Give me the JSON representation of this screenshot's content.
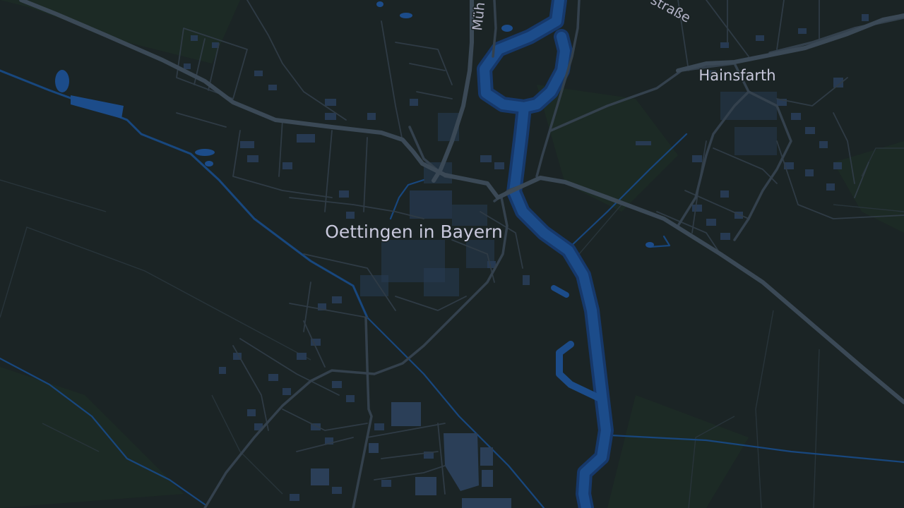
{
  "map": {
    "labels": {
      "town": "Oettingen in Bayern",
      "village": "Hainsfarth",
      "road_top": "Müh",
      "road_top_right": "straße"
    },
    "theme": {
      "background": "#1b2425",
      "water": "#1c4c8a",
      "road": "#3b4956",
      "building": "#273a52",
      "label": "#c8c8dc"
    }
  }
}
